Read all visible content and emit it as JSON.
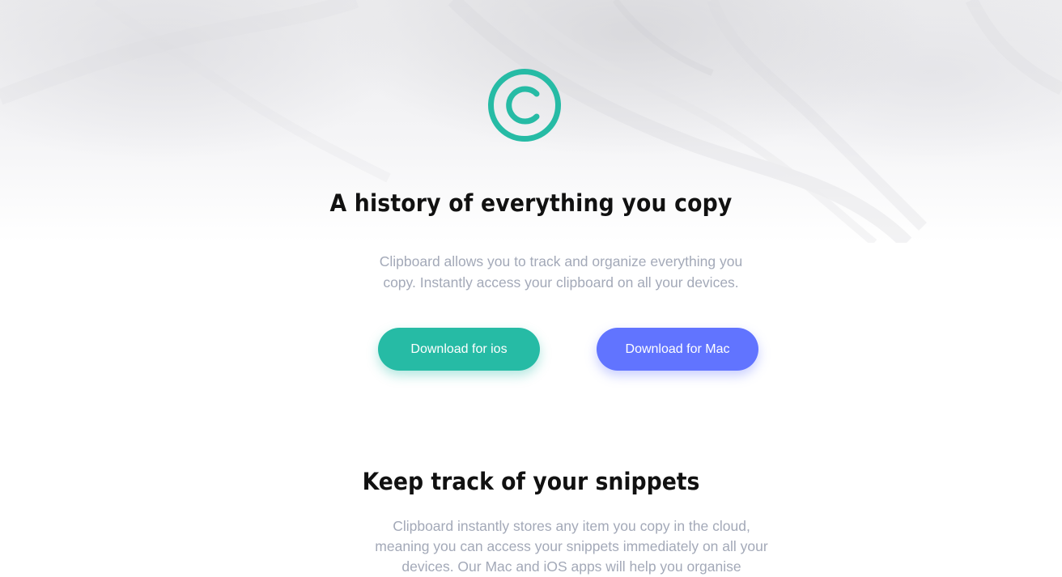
{
  "hero": {
    "logo_icon": "copyright-circle-icon",
    "accent_color": "#26bba5",
    "title": "A history of everything you copy",
    "lead": "Clipboard allows you to track and organize everything you copy. Instantly access your clipboard on all your devices."
  },
  "buttons": {
    "ios_label": "Download for ios",
    "mac_label": "Download for Mac",
    "ios_color": "#26bba5",
    "mac_color": "#6174ff"
  },
  "snippets": {
    "title": "Keep track of your snippets",
    "body": "Clipboard instantly stores any item you copy in the cloud, meaning you can access your snippets immediately on all your devices. Our Mac and iOS apps will help you organise"
  }
}
